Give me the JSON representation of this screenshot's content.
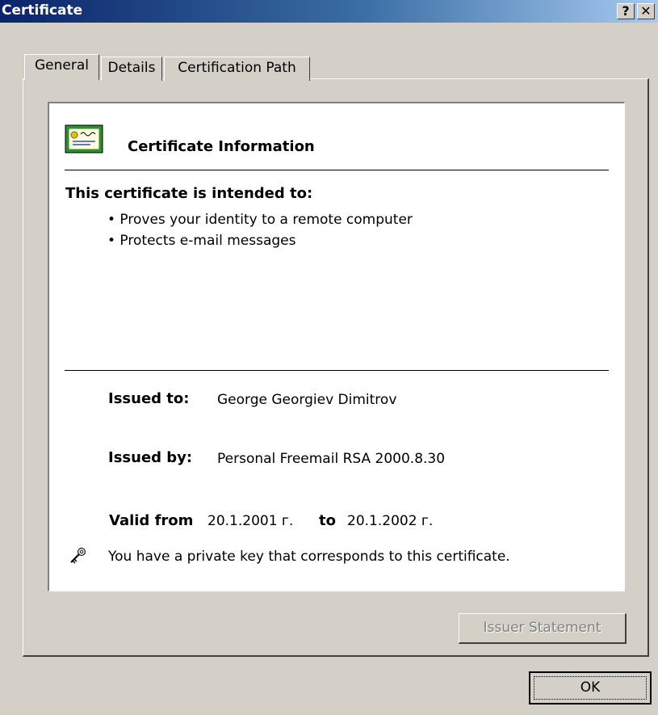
{
  "window": {
    "title": "Certificate",
    "help_label": "?",
    "close_label": "✕"
  },
  "tabs": [
    "General",
    "Details",
    "Certification Path"
  ],
  "info": {
    "header": "Certificate Information",
    "intended_heading": "This certificate is intended to:",
    "purposes": [
      "• Proves your identity to a remote computer",
      "• Protects e-mail messages"
    ],
    "issued_to_label": "Issued to:",
    "issued_to": "George Georgiev Dimitrov",
    "issued_by_label": "Issued by:",
    "issued_by": "Personal Freemail RSA 2000.8.30",
    "valid_from_label": "Valid from",
    "valid_from": "20.1.2001 г.",
    "valid_to_label": "to",
    "valid_to": "20.1.2002 г.",
    "private_key_note": "You have a private key that corresponds to this certificate."
  },
  "buttons": {
    "issuer_statement": "Issuer Statement",
    "ok": "OK"
  },
  "icons": {
    "certificate": "certificate-icon",
    "key": "key-icon"
  },
  "colors": {
    "title_start": "#0a246a",
    "title_end": "#a6caf0",
    "face": "#d4d0c8"
  }
}
